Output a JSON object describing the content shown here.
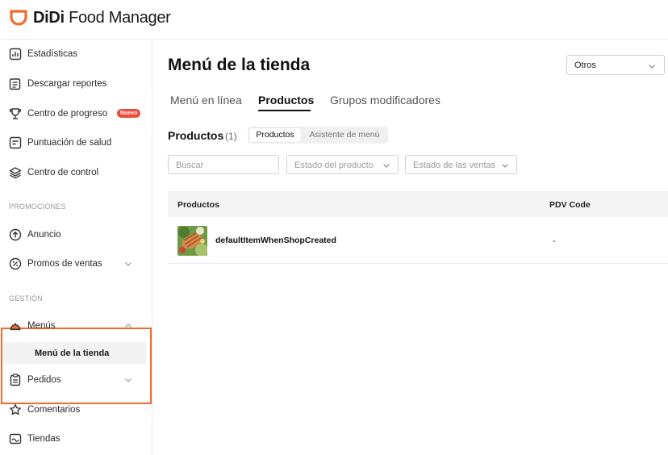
{
  "app": {
    "brand_bold": "DiDi",
    "brand_rest": " Food Manager",
    "accent": "#f26b2b"
  },
  "sidebar": {
    "items": [
      {
        "label": "Estadísticas",
        "icon": "chart-icon"
      },
      {
        "label": "Descargar reportes",
        "icon": "report-icon"
      },
      {
        "label": "Centro de progreso",
        "icon": "trophy-icon",
        "badge": "Nuevo"
      },
      {
        "label": "Puntuación de salud",
        "icon": "health-score-icon"
      },
      {
        "label": "Centro de control",
        "icon": "layers-icon"
      }
    ],
    "promociones_label": "PROMOCIONES",
    "promo_items": [
      {
        "label": "Anuncio",
        "icon": "arrow-up-circle-icon"
      },
      {
        "label": "Promos de ventas",
        "icon": "percent-icon"
      }
    ],
    "gestion_label": "GESTIÓN",
    "menus_label": "Menús",
    "submenu_label": "Menú de la tienda",
    "bottom_items": [
      {
        "label": "Pedidos",
        "icon": "clipboard-icon"
      },
      {
        "label": "Comentarios",
        "icon": "star-icon"
      },
      {
        "label": "Tiendas",
        "icon": "store-icon"
      }
    ]
  },
  "main": {
    "title": "Menú de la tienda",
    "store_select": "Otros",
    "tabs": [
      "Menú en línea",
      "Productos",
      "Grupos modificadores"
    ],
    "active_tab": "Productos",
    "products_heading": "Productos",
    "products_count": "(1)",
    "segments": [
      "Productos",
      "Asistente de menú"
    ],
    "search_placeholder": "Buscar",
    "filter_product_state": "Estado del producto",
    "filter_sales_state": "Estado de las ventas",
    "table": {
      "columns": [
        "Productos",
        "PDV Code"
      ],
      "rows": [
        {
          "name": "defaultItemWhenShopCreated",
          "pdv": "-"
        }
      ]
    }
  }
}
